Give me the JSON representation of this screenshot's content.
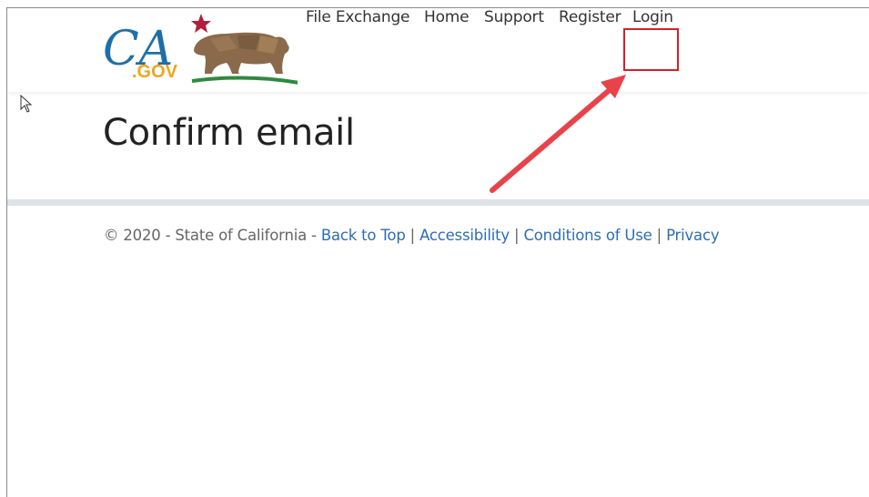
{
  "logo": {
    "text_ca": "CA",
    "text_gov": ".GOV",
    "brand_blue": "#1e6fa8",
    "brand_gold": "#f0a51e",
    "star_color": "#b31f3a",
    "bear_color": "#8a6a4a",
    "ground_color": "#2f8a3e"
  },
  "nav": {
    "items": [
      {
        "label": "File Exchange"
      },
      {
        "label": "Home"
      },
      {
        "label": "Support"
      },
      {
        "label": "Register"
      },
      {
        "label": "Login"
      }
    ]
  },
  "main": {
    "title": "Confirm email"
  },
  "footer": {
    "copyright": "© 2020 - State of California - ",
    "links": [
      {
        "label": "Back to Top"
      },
      {
        "label": "Accessibility"
      },
      {
        "label": "Conditions of Use"
      },
      {
        "label": "Privacy"
      }
    ],
    "separator": " | "
  },
  "annotation": {
    "highlight_color": "#d4202a",
    "arrow_color": "#e8434a"
  }
}
